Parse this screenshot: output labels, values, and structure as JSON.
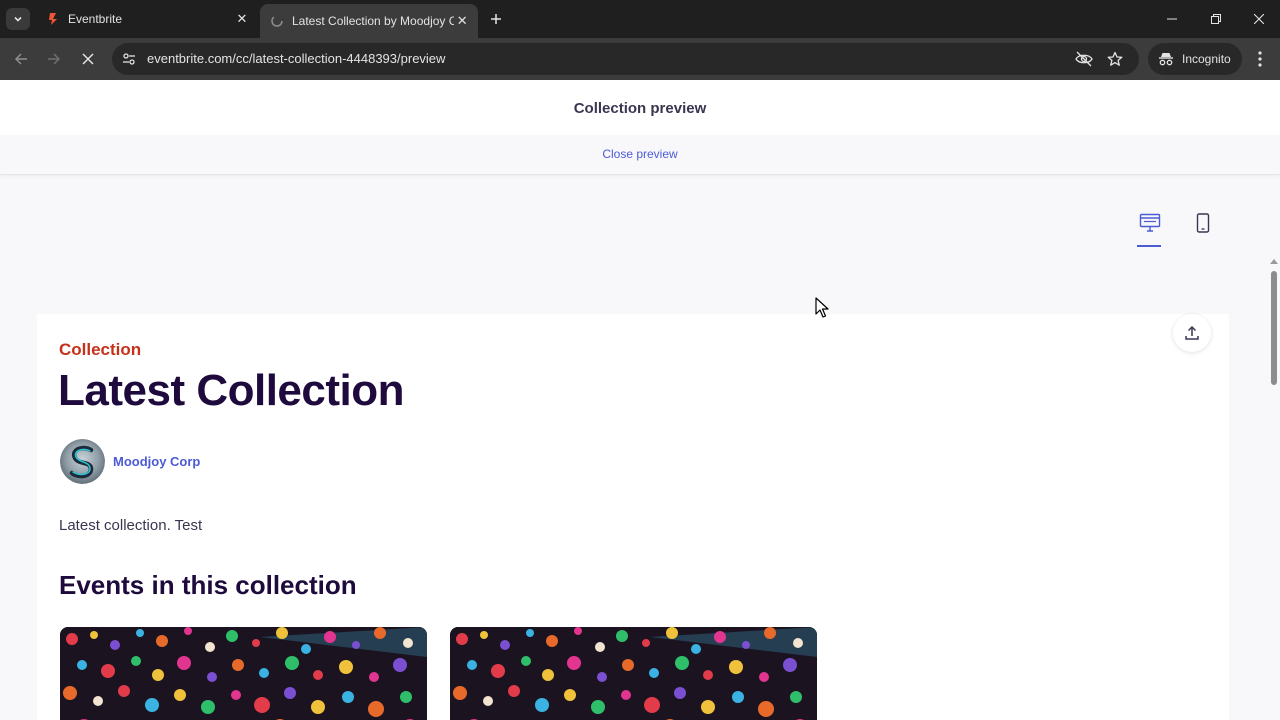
{
  "browser": {
    "tabs": [
      {
        "title": "Eventbrite",
        "active": false
      },
      {
        "title": "Latest Collection by Moodjoy C",
        "active": true
      }
    ],
    "url": "eventbrite.com/cc/latest-collection-4448393/preview",
    "incognito_label": "Incognito"
  },
  "preview": {
    "title": "Collection preview",
    "close_label": "Close preview"
  },
  "collection": {
    "kicker": "Collection",
    "title": "Latest Collection",
    "organizer": "Moodjoy Corp",
    "description": "Latest collection. Test",
    "events_heading": "Events in this collection"
  },
  "colors": {
    "accent": "#4b5bd6",
    "kicker": "#c5311a",
    "heading": "#1e0a3c"
  },
  "icons": [
    "desktop-view-icon",
    "mobile-view-icon",
    "share-icon"
  ]
}
